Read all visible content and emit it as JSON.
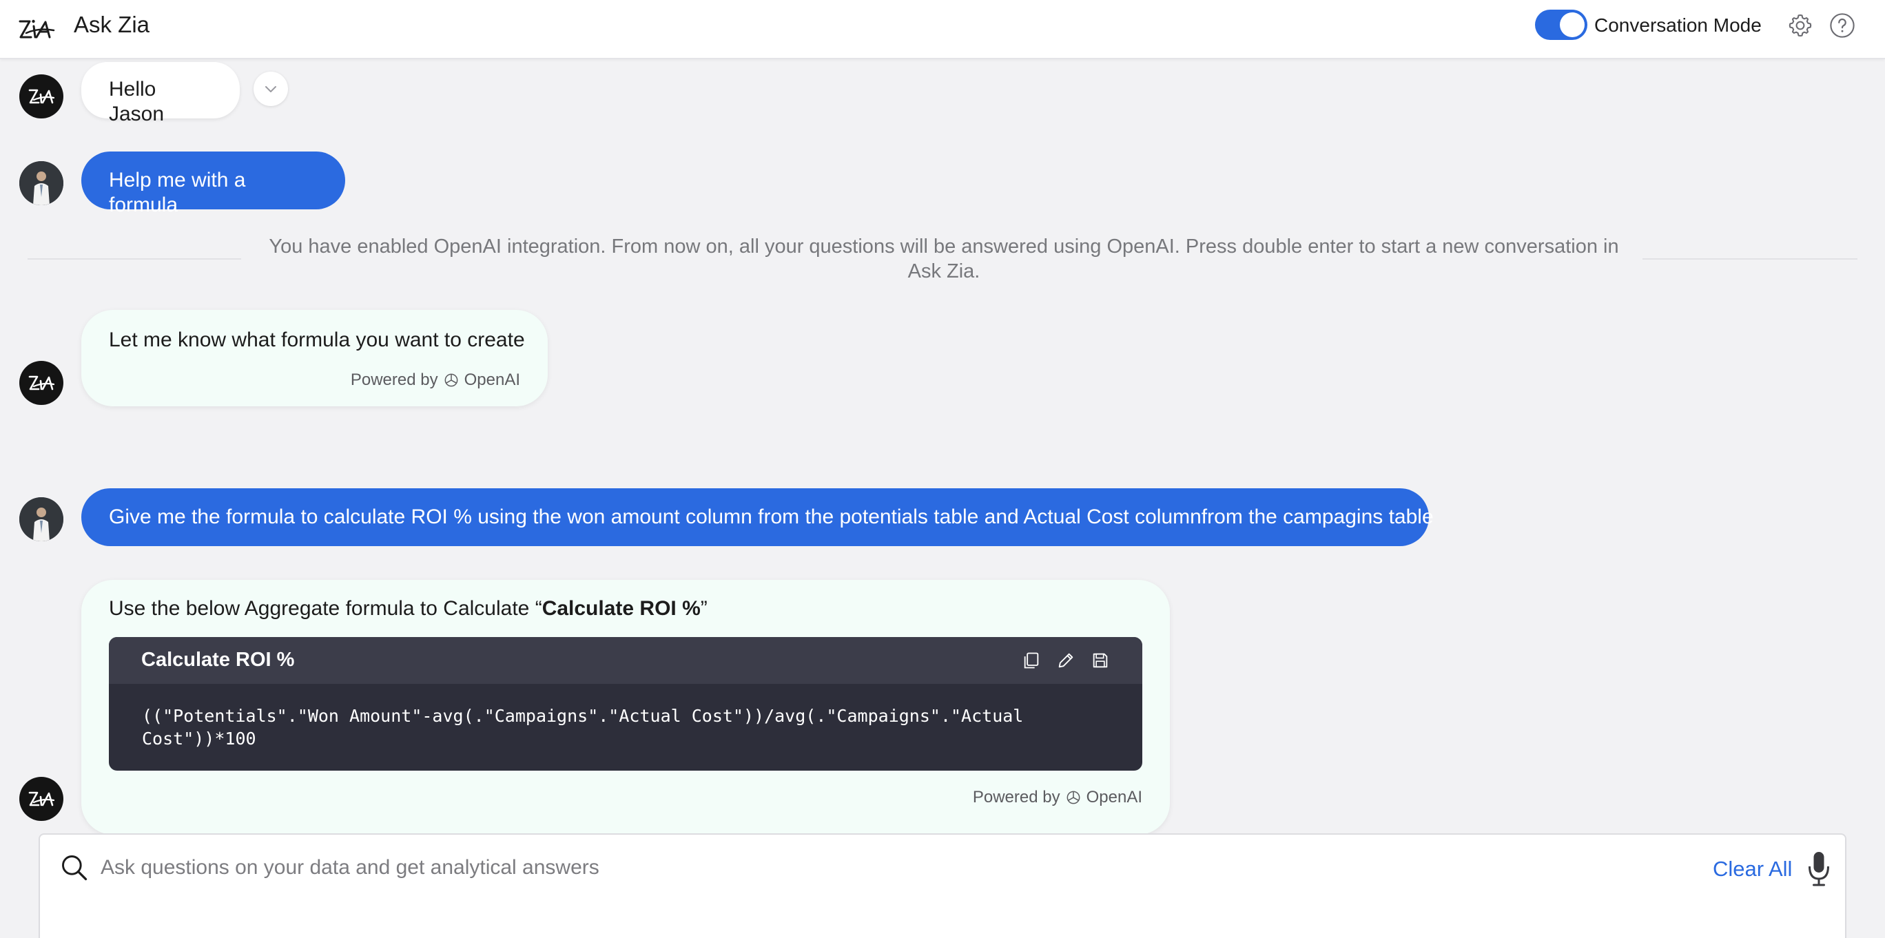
{
  "header": {
    "title": "Ask Zia",
    "logo_icon": "zia-logo",
    "conversation_mode_label": "Conversation Mode",
    "conversation_mode_on": true,
    "accent_color": "#2a6ae0"
  },
  "messages": [
    {
      "sender": "zia",
      "text": "Hello Jason"
    },
    {
      "sender": "user",
      "text": "Help me with a formula"
    },
    {
      "sender": "system",
      "text": "You have enabled OpenAI integration. From now on, all your questions will be answered using OpenAI. Press double enter to start a new conversation in Ask Zia."
    },
    {
      "sender": "zia",
      "text": "Let me know what formula you want to create",
      "powered_by": "Powered by",
      "provider": "OpenAI"
    },
    {
      "sender": "user",
      "text": "Give me the formula to calculate ROI % using the won amount column from the potentials table and Actual Cost columnfrom the campagins table"
    },
    {
      "sender": "zia",
      "intro_prefix": "Use the below Aggregate formula to Calculate “",
      "intro_bold": "Calculate ROI %",
      "intro_suffix": "”",
      "code_title": "Calculate ROI %",
      "code": "((\"Potentials\".\"Won Amount\"-avg(.\"Campaigns\".\"Actual Cost\"))/avg(.\"Campaigns\".\"Actual Cost\"))*100",
      "powered_by": "Powered by",
      "provider": "OpenAI"
    }
  ],
  "input": {
    "placeholder": "Ask questions on your data and get analytical answers",
    "value": "",
    "clear_label": "Clear All"
  }
}
